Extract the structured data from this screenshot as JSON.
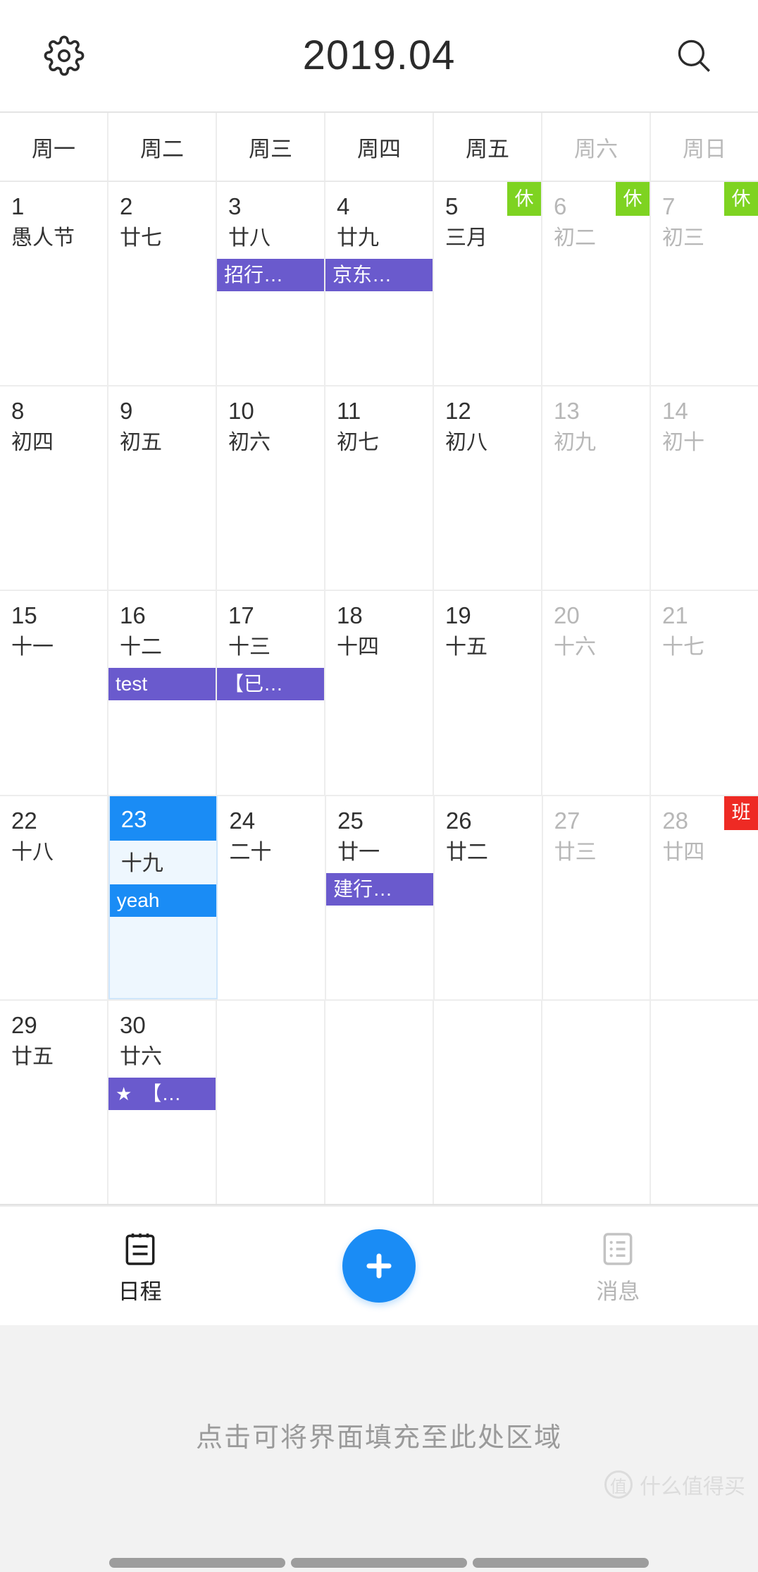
{
  "header": {
    "title": "2019.04",
    "settings_icon": "gear-icon",
    "search_icon": "search-icon"
  },
  "weekdays": [
    {
      "label": "周一",
      "weekend": false
    },
    {
      "label": "周二",
      "weekend": false
    },
    {
      "label": "周三",
      "weekend": false
    },
    {
      "label": "周四",
      "weekend": false
    },
    {
      "label": "周五",
      "weekend": false
    },
    {
      "label": "周六",
      "weekend": true
    },
    {
      "label": "周日",
      "weekend": true
    }
  ],
  "weeks": [
    [
      {
        "day": "1",
        "lunar": "愚人节",
        "dim": false,
        "selected": false,
        "badge": null,
        "events": []
      },
      {
        "day": "2",
        "lunar": "廿七",
        "dim": false,
        "selected": false,
        "badge": null,
        "events": []
      },
      {
        "day": "3",
        "lunar": "廿八",
        "dim": false,
        "selected": false,
        "badge": null,
        "events": [
          {
            "text": "招行…",
            "color": "purple",
            "star": false
          }
        ]
      },
      {
        "day": "4",
        "lunar": "廿九",
        "dim": false,
        "selected": false,
        "badge": null,
        "events": [
          {
            "text": "京东…",
            "color": "purple",
            "star": false
          }
        ]
      },
      {
        "day": "5",
        "lunar": "三月",
        "dim": false,
        "selected": false,
        "badge": "休",
        "events": []
      },
      {
        "day": "6",
        "lunar": "初二",
        "dim": true,
        "selected": false,
        "badge": "休",
        "events": []
      },
      {
        "day": "7",
        "lunar": "初三",
        "dim": true,
        "selected": false,
        "badge": "休",
        "events": []
      }
    ],
    [
      {
        "day": "8",
        "lunar": "初四",
        "dim": false,
        "selected": false,
        "badge": null,
        "events": []
      },
      {
        "day": "9",
        "lunar": "初五",
        "dim": false,
        "selected": false,
        "badge": null,
        "events": []
      },
      {
        "day": "10",
        "lunar": "初六",
        "dim": false,
        "selected": false,
        "badge": null,
        "events": []
      },
      {
        "day": "11",
        "lunar": "初七",
        "dim": false,
        "selected": false,
        "badge": null,
        "events": []
      },
      {
        "day": "12",
        "lunar": "初八",
        "dim": false,
        "selected": false,
        "badge": null,
        "events": []
      },
      {
        "day": "13",
        "lunar": "初九",
        "dim": true,
        "selected": false,
        "badge": null,
        "events": []
      },
      {
        "day": "14",
        "lunar": "初十",
        "dim": true,
        "selected": false,
        "badge": null,
        "events": []
      }
    ],
    [
      {
        "day": "15",
        "lunar": "十一",
        "dim": false,
        "selected": false,
        "badge": null,
        "events": []
      },
      {
        "day": "16",
        "lunar": "十二",
        "dim": false,
        "selected": false,
        "badge": null,
        "events": [
          {
            "text": "test",
            "color": "purple",
            "star": false
          }
        ]
      },
      {
        "day": "17",
        "lunar": "十三",
        "dim": false,
        "selected": false,
        "badge": null,
        "events": [
          {
            "text": "【已…",
            "color": "purple",
            "star": false
          }
        ]
      },
      {
        "day": "18",
        "lunar": "十四",
        "dim": false,
        "selected": false,
        "badge": null,
        "events": []
      },
      {
        "day": "19",
        "lunar": "十五",
        "dim": false,
        "selected": false,
        "badge": null,
        "events": []
      },
      {
        "day": "20",
        "lunar": "十六",
        "dim": true,
        "selected": false,
        "badge": null,
        "events": []
      },
      {
        "day": "21",
        "lunar": "十七",
        "dim": true,
        "selected": false,
        "badge": null,
        "events": []
      }
    ],
    [
      {
        "day": "22",
        "lunar": "十八",
        "dim": false,
        "selected": false,
        "badge": null,
        "events": []
      },
      {
        "day": "23",
        "lunar": "十九",
        "dim": false,
        "selected": true,
        "badge": null,
        "events": [
          {
            "text": "yeah",
            "color": "blue",
            "star": false
          }
        ]
      },
      {
        "day": "24",
        "lunar": "二十",
        "dim": false,
        "selected": false,
        "badge": null,
        "events": []
      },
      {
        "day": "25",
        "lunar": "廿一",
        "dim": false,
        "selected": false,
        "badge": null,
        "events": [
          {
            "text": "建行…",
            "color": "purple",
            "star": false
          }
        ]
      },
      {
        "day": "26",
        "lunar": "廿二",
        "dim": false,
        "selected": false,
        "badge": null,
        "events": []
      },
      {
        "day": "27",
        "lunar": "廿三",
        "dim": true,
        "selected": false,
        "badge": null,
        "events": []
      },
      {
        "day": "28",
        "lunar": "廿四",
        "dim": true,
        "selected": false,
        "badge": "班",
        "events": []
      }
    ],
    [
      {
        "day": "29",
        "lunar": "廿五",
        "dim": false,
        "selected": false,
        "badge": null,
        "events": []
      },
      {
        "day": "30",
        "lunar": "廿六",
        "dim": false,
        "selected": false,
        "badge": null,
        "events": [
          {
            "text": "【…",
            "color": "purple",
            "star": true
          }
        ]
      },
      {
        "day": "",
        "lunar": "",
        "dim": false,
        "selected": false,
        "badge": null,
        "events": []
      },
      {
        "day": "",
        "lunar": "",
        "dim": false,
        "selected": false,
        "badge": null,
        "events": []
      },
      {
        "day": "",
        "lunar": "",
        "dim": false,
        "selected": false,
        "badge": null,
        "events": []
      },
      {
        "day": "",
        "lunar": "",
        "dim": false,
        "selected": false,
        "badge": null,
        "events": []
      },
      {
        "day": "",
        "lunar": "",
        "dim": false,
        "selected": false,
        "badge": null,
        "events": []
      }
    ]
  ],
  "bottom_nav": {
    "schedule_label": "日程",
    "schedule_icon": "calendar-note-icon",
    "add_icon": "plus-icon",
    "messages_label": "消息",
    "messages_icon": "list-message-icon"
  },
  "filler": {
    "text": "点击可将界面填充至此处区域",
    "watermark": "什么值得买",
    "watermark_badge": "值"
  },
  "colors": {
    "accent_blue": "#1a8cf5",
    "event_purple": "#6a5acd",
    "rest_green": "#7ed321",
    "work_red": "#ee2a24",
    "selected_cell": "#eef7fe"
  }
}
